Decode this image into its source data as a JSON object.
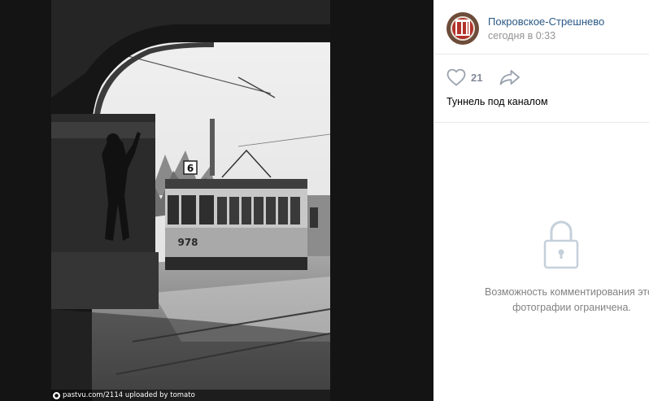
{
  "photo": {
    "credit_text": "pastvu.com/2114 uploaded by tomato",
    "tram_route": "6",
    "tram_number": "978"
  },
  "post": {
    "author": "Покровское-Стрешнево",
    "time": "сегодня в 0:33",
    "likes": "21",
    "caption": "Туннель под каналом"
  },
  "comments": {
    "blocked_line1": "Возможность комментирования этой",
    "blocked_line2": "фотографии ограничена."
  },
  "colors": {
    "link": "#2a5885",
    "muted": "#939393",
    "icon": "#99a2ad",
    "lock": "#c5d0db",
    "viewer_bg": "#141414"
  },
  "icons": [
    "credit-icon",
    "avatar",
    "heart-icon",
    "share-icon",
    "lock-icon"
  ]
}
